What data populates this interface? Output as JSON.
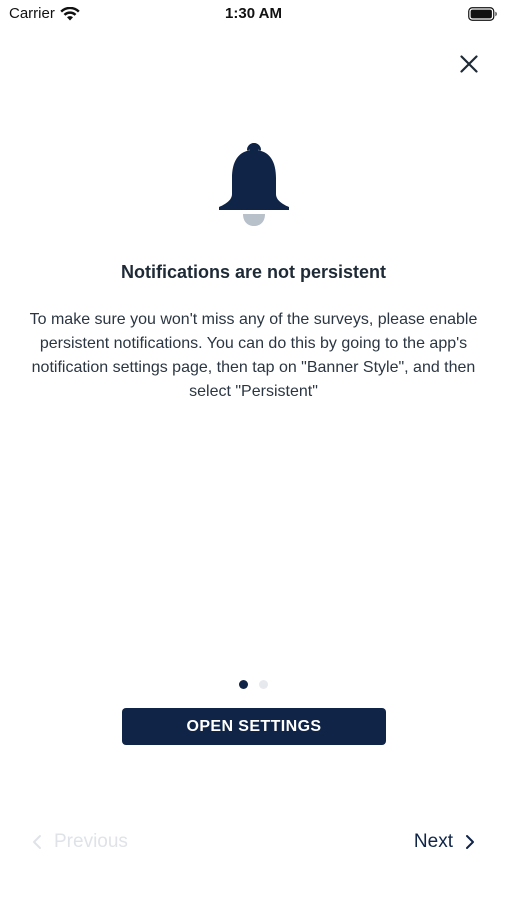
{
  "status_bar": {
    "carrier": "Carrier",
    "time": "1:30 AM"
  },
  "icons": {
    "close": "close-icon",
    "bell": "bell-icon",
    "wifi": "wifi-icon",
    "battery": "battery-icon",
    "chevron_left": "chevron-left-icon",
    "chevron_right": "chevron-right-icon"
  },
  "content": {
    "title": "Notifications are not persistent",
    "body": "To make sure you won't miss any of the surveys, please enable persistent notifications. You can do this by going to the app's notification settings page, then tap on \"Banner Style\", and then select \"Persistent\""
  },
  "pager": {
    "total": 2,
    "current": 1
  },
  "actions": {
    "open_settings_label": "OPEN SETTINGS"
  },
  "navigation": {
    "previous_label": "Previous",
    "next_label": "Next"
  },
  "colors": {
    "accent": "#0f2447",
    "disabled": "#dfe3e8",
    "dot_inactive": "#e6e9ee",
    "bell_clapper": "#b8c0ca"
  }
}
